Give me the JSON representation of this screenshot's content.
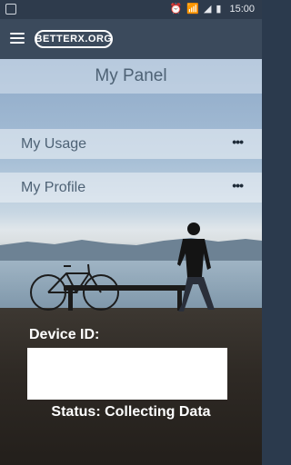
{
  "status_bar": {
    "time": "15:00",
    "icons": [
      "image-icon",
      "alarm-icon",
      "wifi-icon",
      "signal-icon",
      "battery-icon"
    ]
  },
  "app_bar": {
    "logo_text": "BETTERX.ORG"
  },
  "panel": {
    "title": "My Panel",
    "items": [
      {
        "label": "My Usage",
        "more": "•••"
      },
      {
        "label": "My Profile",
        "more": "•••"
      }
    ]
  },
  "device": {
    "label": "Device ID:",
    "value": ""
  },
  "status": {
    "text": "Status: Collecting Data"
  }
}
